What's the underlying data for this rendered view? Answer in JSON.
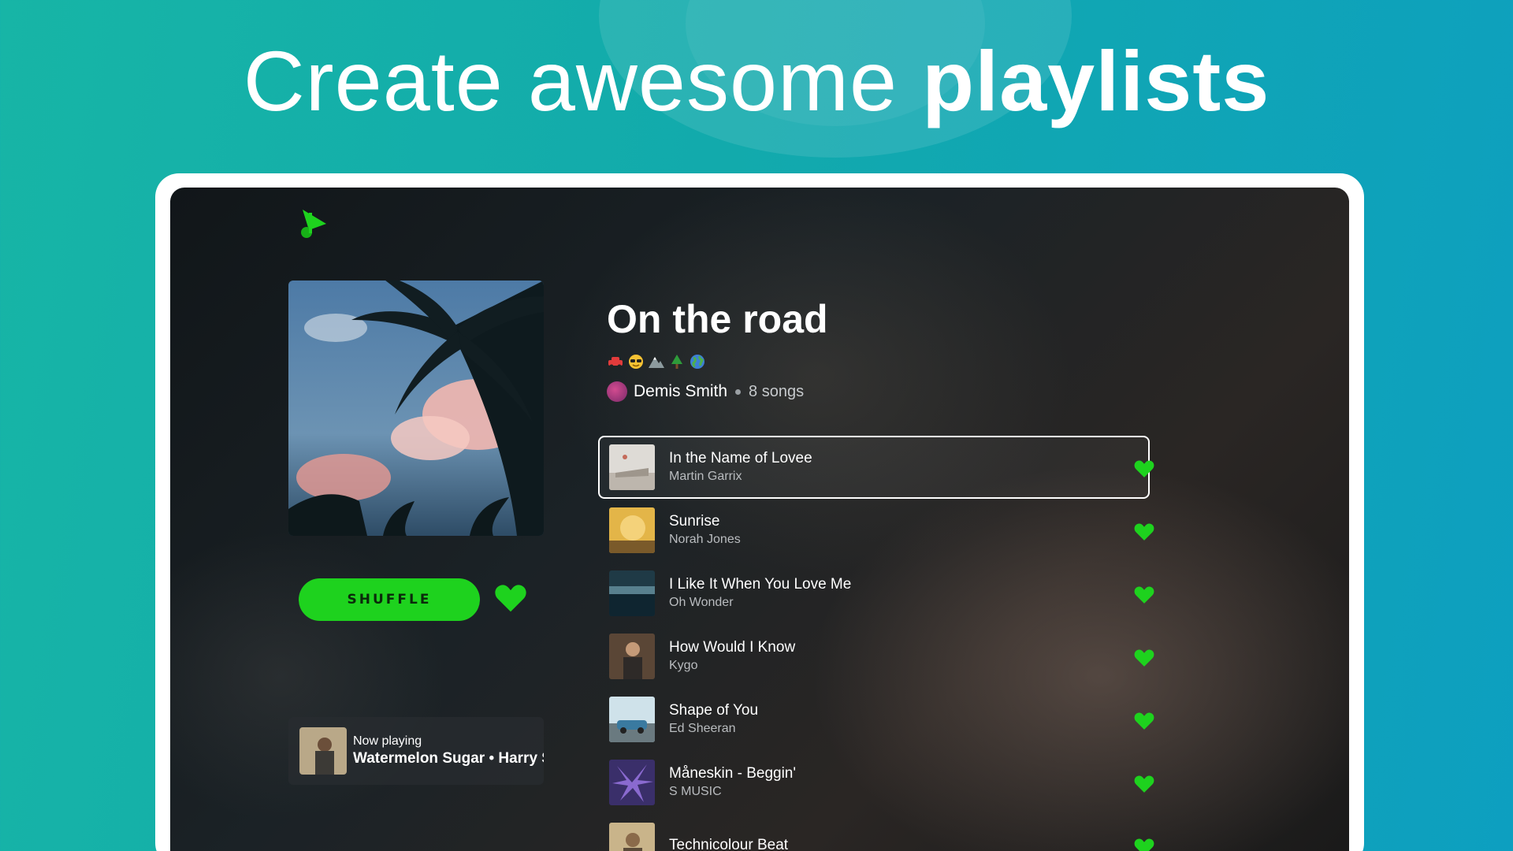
{
  "headline": {
    "light": "Create awesome",
    "bold": "playlists"
  },
  "colors": {
    "accent": "#1ed21e",
    "bg_start": "#17b5a6",
    "bg_end": "#0d9fc0"
  },
  "app": {
    "logo": "music-note-logo",
    "playlist": {
      "title": "On the road",
      "emojis": [
        "car",
        "sunglasses-face",
        "mountain",
        "tree",
        "globe"
      ],
      "owner": "Demis Smith",
      "song_count": "8 songs"
    },
    "shuffle_label": "SHUFFLE",
    "now_playing": {
      "label": "Now playing",
      "track": "Watermelon Sugar • Harry Styles"
    },
    "tracks": [
      {
        "title": "In the Name of Lovee",
        "artist": "Martin Garrix",
        "selected": true
      },
      {
        "title": "Sunrise",
        "artist": "Norah Jones"
      },
      {
        "title": "I Like It When You Love Me",
        "artist": "Oh Wonder"
      },
      {
        "title": "How Would I Know",
        "artist": "Kygo"
      },
      {
        "title": "Shape of You",
        "artist": "Ed Sheeran"
      },
      {
        "title": "Måneskin - Beggin'",
        "artist": "S MUSIC"
      },
      {
        "title": "Technicolour Beat",
        "artist": ""
      }
    ]
  }
}
